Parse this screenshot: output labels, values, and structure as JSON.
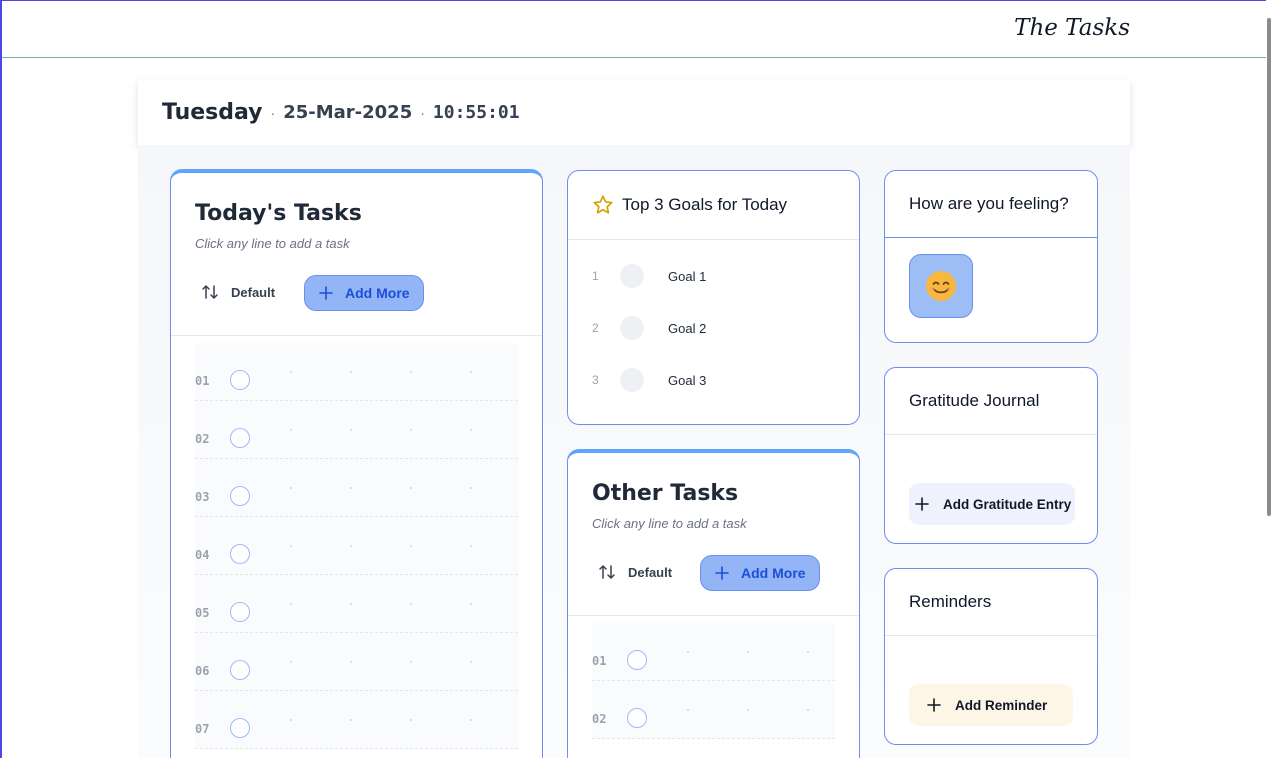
{
  "app": {
    "title": "The Tasks"
  },
  "datebar": {
    "day": "Tuesday",
    "date": "25-Mar-2025",
    "time": "10:55:01",
    "separator": "·"
  },
  "todays_tasks": {
    "title": "Today's Tasks",
    "subtitle": "Click any line to add a task",
    "sort_label": "Default",
    "add_label": "Add More",
    "lines": [
      "01",
      "02",
      "03",
      "04",
      "05",
      "06",
      "07"
    ]
  },
  "goals": {
    "title": "Top 3 Goals for Today",
    "items": [
      {
        "num": "1",
        "label": "Goal 1"
      },
      {
        "num": "2",
        "label": "Goal 2"
      },
      {
        "num": "3",
        "label": "Goal 3"
      }
    ]
  },
  "other_tasks": {
    "title": "Other Tasks",
    "subtitle": "Click any line to add a task",
    "sort_label": "Default",
    "add_label": "Add More",
    "lines": [
      "01",
      "02"
    ]
  },
  "feeling": {
    "title": "How are you feeling?",
    "emoji": "😊"
  },
  "gratitude": {
    "title": "Gratitude Journal",
    "add_label": "Add Gratitude Entry"
  },
  "reminders": {
    "title": "Reminders",
    "add_label": "Add Reminder"
  },
  "colors": {
    "accent": "#60a5fa",
    "border": "#6b8ff0",
    "button_fill": "#93b4f5",
    "button_text": "#1d4ed8",
    "frame": "#4f46e5"
  },
  "icons": [
    "sort-icon",
    "plus-icon",
    "star-icon",
    "smiley-emoji"
  ]
}
